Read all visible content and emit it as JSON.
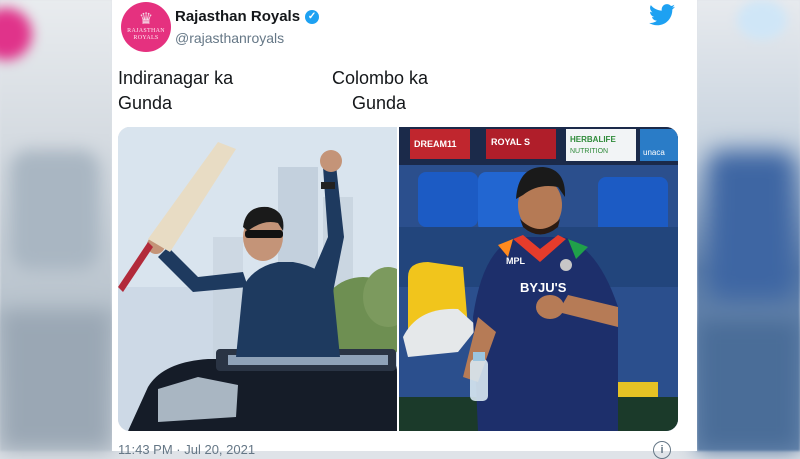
{
  "tweet": {
    "display_name": "Rajasthan Royals",
    "handle": "@rajasthanroyals",
    "avatar_text": "RAJASTHAN\nROYALS",
    "caption_left": "Indiranagar ka\nGunda",
    "caption_right": "Colombo ka\n    Gunda",
    "timestamp": "11:43 PM · Jul 20, 2021",
    "icons": [
      "verified-badge-icon",
      "twitter-bird-icon",
      "info-icon"
    ],
    "photo_left": {
      "banners": []
    },
    "photo_right": {
      "banners": [
        "ROYAL S",
        "DREAM11",
        "HERBALIFE NUTRITION",
        "unaca"
      ],
      "jersey_text": "MPL",
      "shirt_text": "BYJU'S"
    }
  },
  "colors": {
    "brand_pink": "#e5317f",
    "twitter_blue": "#1da1f2",
    "text_primary": "#14171a",
    "text_secondary": "#657786"
  }
}
